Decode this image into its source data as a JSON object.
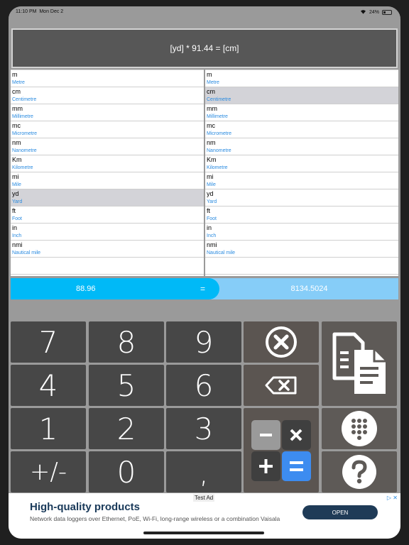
{
  "status": {
    "time": "11:10 PM",
    "date": "Mon Dec 2",
    "battery": "24%"
  },
  "formula": "[yd] * 91.44 = [cm]",
  "left_units": [
    {
      "symbol": "m",
      "name": "Metre"
    },
    {
      "symbol": "cm",
      "name": "Centimetre"
    },
    {
      "symbol": "mm",
      "name": "Millimetre"
    },
    {
      "symbol": "mc",
      "name": "Micrometre"
    },
    {
      "symbol": "nm",
      "name": "Nanometre"
    },
    {
      "symbol": "Km",
      "name": "Kilometre"
    },
    {
      "symbol": "mi",
      "name": "Mile"
    },
    {
      "symbol": "yd",
      "name": "Yard"
    },
    {
      "symbol": "ft",
      "name": "Foot"
    },
    {
      "symbol": "in",
      "name": "Inch"
    },
    {
      "symbol": "nmi",
      "name": "Nautical mile"
    }
  ],
  "right_units": [
    {
      "symbol": "m",
      "name": "Metre"
    },
    {
      "symbol": "cm",
      "name": "Centimetre"
    },
    {
      "symbol": "mm",
      "name": "Millimetre"
    },
    {
      "symbol": "mc",
      "name": "Micrometre"
    },
    {
      "symbol": "nm",
      "name": "Nanometre"
    },
    {
      "symbol": "Km",
      "name": "Kilometre"
    },
    {
      "symbol": "mi",
      "name": "Mile"
    },
    {
      "symbol": "yd",
      "name": "Yard"
    },
    {
      "symbol": "ft",
      "name": "Foot"
    },
    {
      "symbol": "in",
      "name": "Inch"
    },
    {
      "symbol": "nmi",
      "name": "Nautical mile"
    }
  ],
  "left_selected": "yd",
  "right_selected": "cm",
  "result": {
    "input": "88.96",
    "equals": "=",
    "output": "8134.5024"
  },
  "keys": {
    "k7": "7",
    "k8": "8",
    "k9": "9",
    "k4": "4",
    "k5": "5",
    "k6": "6",
    "k1": "1",
    "k2": "2",
    "k3": "3",
    "sign": "+/-",
    "k0": "0",
    "comma": ","
  },
  "icons": {
    "clear": "clear-circle-x-icon",
    "backspace": "backspace-icon",
    "copy": "copy-documents-icon",
    "calculator": "calculator-icon",
    "grid": "keypad-grid-icon",
    "help": "question-mark-icon"
  },
  "ad": {
    "label": "Test Ad",
    "title": "High-quality products",
    "subtitle": "Network data loggers over Ethernet, PoE, Wi-Fi, long-range wireless or a combination Vaisala",
    "button": "OPEN",
    "close": "▷ ✕"
  },
  "colors": {
    "accent": "#00b9f7",
    "accent_light": "#86cdf8",
    "key": "#474747",
    "key_brown": "#5b5551",
    "calc_blue": "#3d8cf0"
  }
}
